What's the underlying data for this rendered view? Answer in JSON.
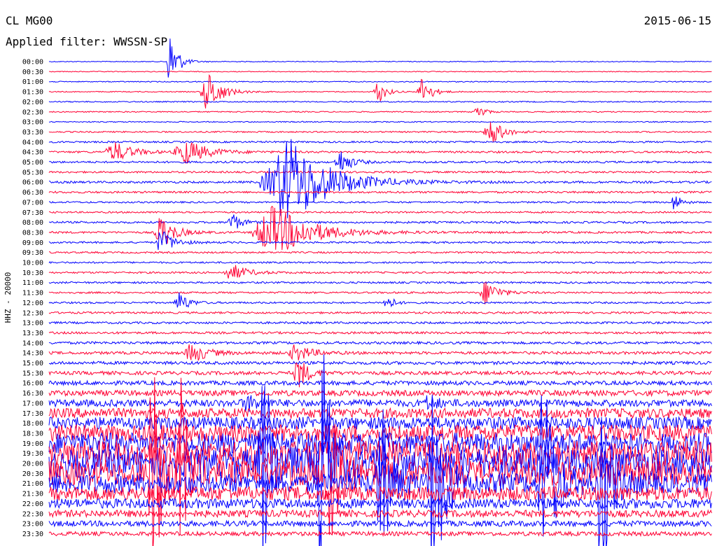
{
  "header": {
    "station": "CL MG00",
    "date": "2015-06-15",
    "filter": "Applied filter: WWSSN-SP"
  },
  "chart_data": {
    "type": "line",
    "channel_label": "HHZ - 20000",
    "trace_colors": [
      "#0000ff",
      "#ff0033"
    ],
    "tick_labels": [
      "00:00",
      "00:30",
      "01:00",
      "01:30",
      "02:00",
      "02:30",
      "03:00",
      "03:30",
      "04:00",
      "04:30",
      "05:00",
      "05:30",
      "06:00",
      "06:30",
      "07:00",
      "07:30",
      "08:00",
      "08:30",
      "09:00",
      "09:30",
      "10:00",
      "10:30",
      "11:00",
      "11:30",
      "12:00",
      "12:30",
      "13:00",
      "13:30",
      "14:00",
      "14:30",
      "15:00",
      "15:30",
      "16:00",
      "16:30",
      "17:00",
      "17:30",
      "18:00",
      "18:30",
      "19:00",
      "19:30",
      "20:00",
      "20:30",
      "21:00",
      "21:30",
      "22:00",
      "22:30",
      "23:00",
      "23:30"
    ],
    "x_range_minutes": [
      0,
      30
    ],
    "background_noise": [
      0.6,
      0.6,
      0.7,
      0.7,
      0.8,
      0.8,
      0.8,
      1,
      1.2,
      1.4,
      1.4,
      1.3,
      1.5,
      1.4,
      1.2,
      1.2,
      1.4,
      1.4,
      1.3,
      1.2,
      1.2,
      1.3,
      1.3,
      1.3,
      1.3,
      1.4,
      1.5,
      1.6,
      1.8,
      2,
      2.2,
      2.5,
      3,
      4,
      5,
      7,
      9,
      12,
      15,
      18,
      20,
      18,
      14,
      10,
      7,
      5,
      4,
      3
    ],
    "events": [
      {
        "row": 0,
        "minute": 5.5,
        "amplitude": 45,
        "width_min": 0.5
      },
      {
        "row": 3,
        "minute": 7.2,
        "amplitude": 30,
        "width_min": 0.9
      },
      {
        "row": 3,
        "minute": 14.9,
        "amplitude": 18,
        "width_min": 0.5
      },
      {
        "row": 3,
        "minute": 16.9,
        "amplitude": 22,
        "width_min": 0.6
      },
      {
        "row": 5,
        "minute": 19.4,
        "amplitude": 14,
        "width_min": 0.4
      },
      {
        "row": 7,
        "minute": 20.0,
        "amplitude": 20,
        "width_min": 0.8
      },
      {
        "row": 9,
        "minute": 3.0,
        "amplitude": 14,
        "width_min": 1.2
      },
      {
        "row": 9,
        "minute": 6.2,
        "amplitude": 18,
        "width_min": 1.4
      },
      {
        "row": 10,
        "minute": 13.2,
        "amplitude": 18,
        "width_min": 0.7
      },
      {
        "row": 12,
        "minute": 10.7,
        "amplitude": 40,
        "width_min": 3.0
      },
      {
        "row": 12,
        "minute": 11.0,
        "amplitude": 28,
        "width_min": 2.0
      },
      {
        "row": 14,
        "minute": 28.3,
        "amplitude": 15,
        "width_min": 0.4
      },
      {
        "row": 16,
        "minute": 8.3,
        "amplitude": 14,
        "width_min": 0.6
      },
      {
        "row": 17,
        "minute": 10.2,
        "amplitude": 38,
        "width_min": 2.5
      },
      {
        "row": 17,
        "minute": 5.1,
        "amplitude": 24,
        "width_min": 0.9
      },
      {
        "row": 18,
        "minute": 5.1,
        "amplitude": 18,
        "width_min": 0.8
      },
      {
        "row": 21,
        "minute": 8.3,
        "amplitude": 12,
        "width_min": 1.0
      },
      {
        "row": 23,
        "minute": 19.8,
        "amplitude": 18,
        "width_min": 0.8
      },
      {
        "row": 24,
        "minute": 5.9,
        "amplitude": 16,
        "width_min": 0.6
      },
      {
        "row": 24,
        "minute": 15.3,
        "amplitude": 14,
        "width_min": 0.4
      },
      {
        "row": 29,
        "minute": 6.5,
        "amplitude": 14,
        "width_min": 1.0
      },
      {
        "row": 29,
        "minute": 11.2,
        "amplitude": 12,
        "width_min": 1.0
      },
      {
        "row": 31,
        "minute": 11.3,
        "amplitude": 25,
        "width_min": 0.6
      },
      {
        "row": 34,
        "minute": 9.0,
        "amplitude": 10,
        "width_min": 0.8
      },
      {
        "row": 34,
        "minute": 17.2,
        "amplitude": 10,
        "width_min": 0.6
      },
      {
        "row": 42,
        "minute": 15.0,
        "amplitude": 130,
        "width_min": 0.6
      },
      {
        "row": 42,
        "minute": 17.4,
        "amplitude": 160,
        "width_min": 0.7
      },
      {
        "row": 42,
        "minute": 22.4,
        "amplitude": 170,
        "width_min": 0.7
      },
      {
        "row": 42,
        "minute": 25.0,
        "amplitude": 150,
        "width_min": 0.6
      },
      {
        "row": 41,
        "minute": 4.7,
        "amplitude": 170,
        "width_min": 0.6
      },
      {
        "row": 41,
        "minute": 6.0,
        "amplitude": 120,
        "width_min": 0.5
      },
      {
        "row": 41,
        "minute": 12.7,
        "amplitude": 150,
        "width_min": 0.6
      },
      {
        "row": 40,
        "minute": 9.7,
        "amplitude": 160,
        "width_min": 0.6
      },
      {
        "row": 40,
        "minute": 12.3,
        "amplitude": 200,
        "width_min": 0.6
      }
    ]
  }
}
